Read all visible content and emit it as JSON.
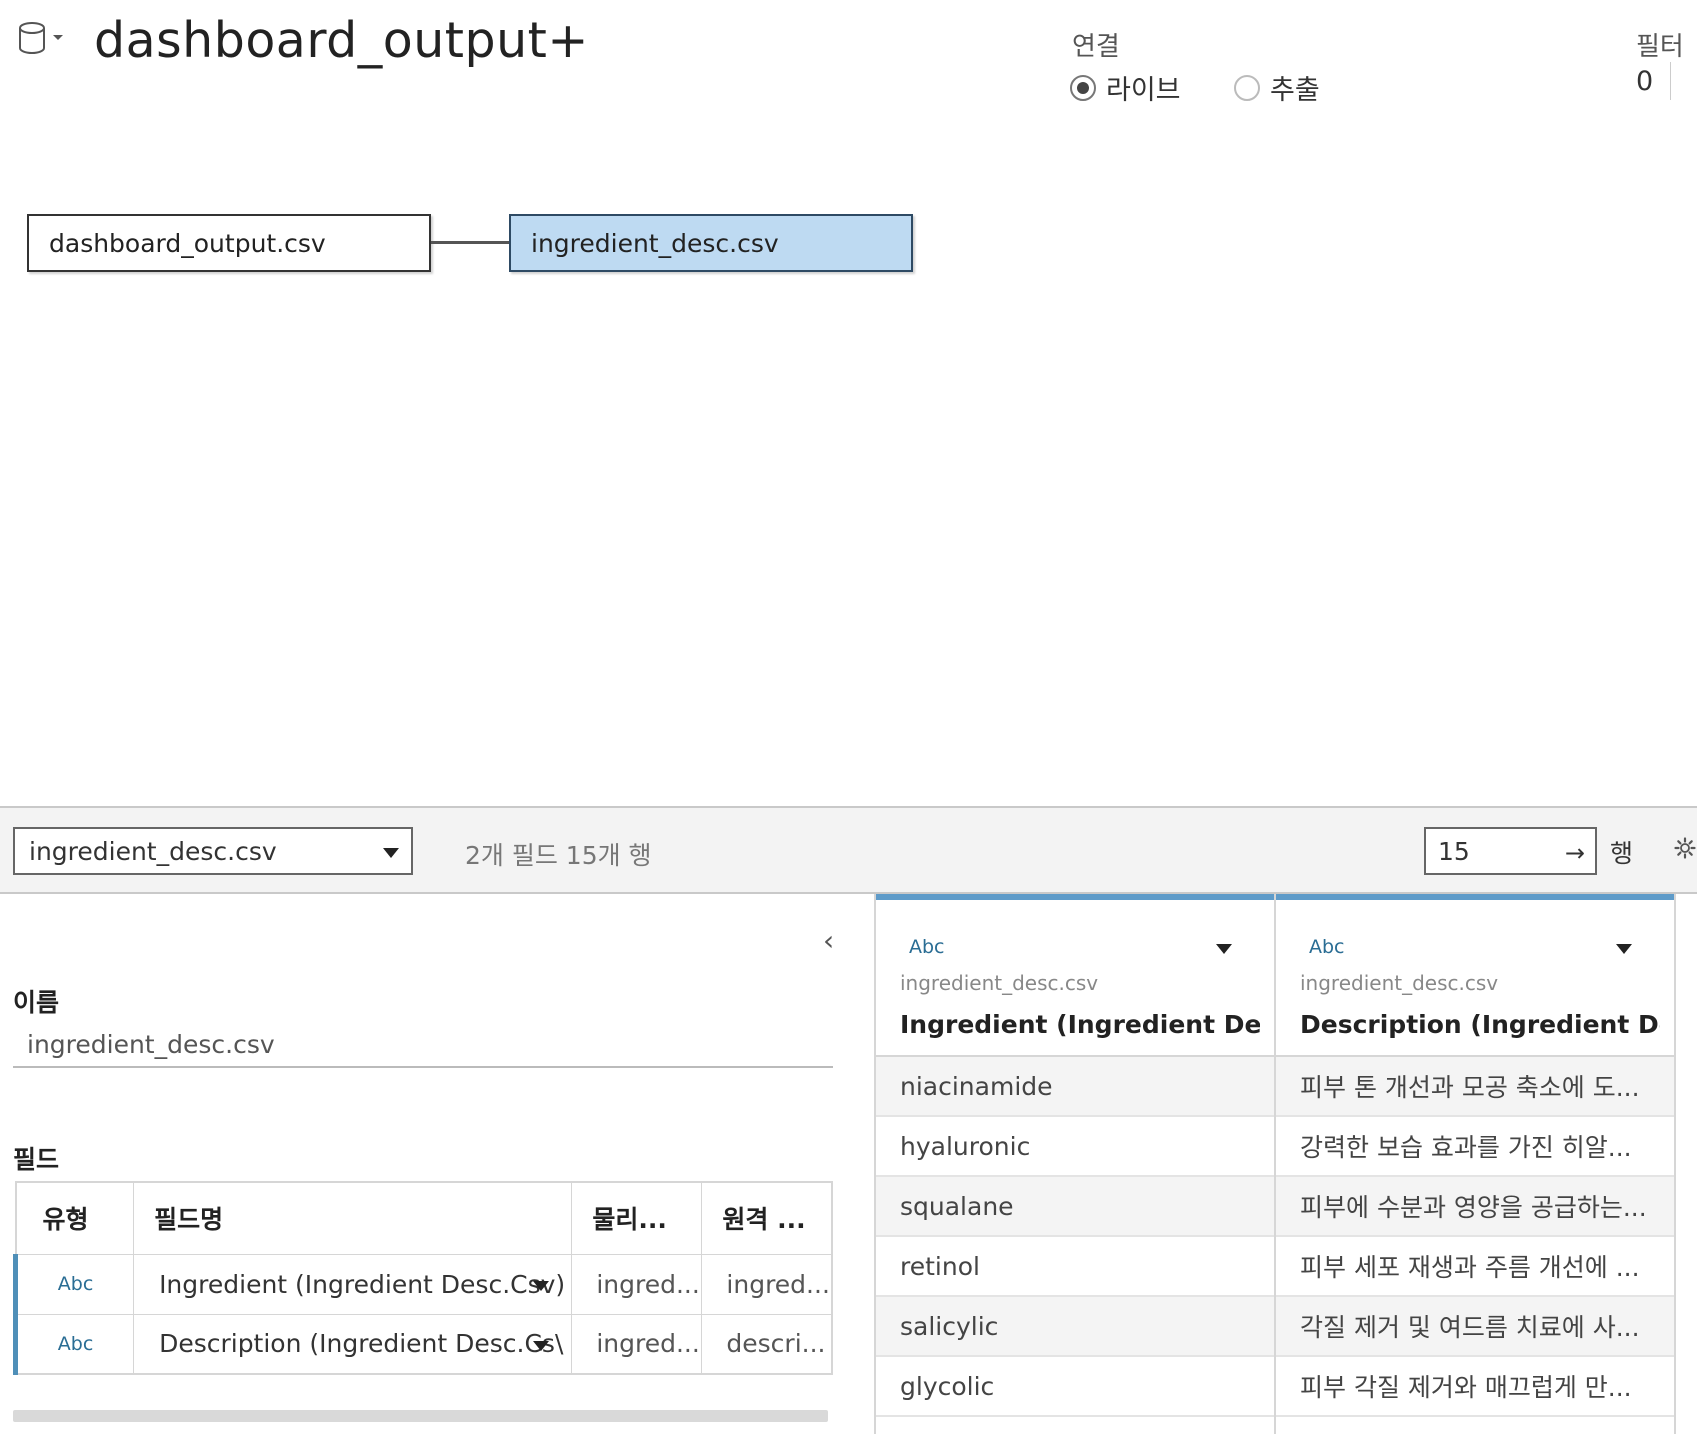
{
  "header": {
    "datasource_title": "dashboard_output+",
    "datasource_icon": "database-icon",
    "connection_label": "연결",
    "connection_options": [
      {
        "label": "라이브",
        "selected": true
      },
      {
        "label": "추출",
        "selected": false
      }
    ],
    "filter_label": "필터",
    "filter_count": "0"
  },
  "canvas": {
    "left_table": "dashboard_output.csv",
    "right_table": "ingredient_desc.csv",
    "selected_color": "#bedaf2"
  },
  "toolbar": {
    "table_select_value": "ingredient_desc.csv",
    "field_summary": "2개 필드 15개 행",
    "row_limit": "15",
    "row_unit": "행",
    "go_arrow": "→",
    "gear_icon": "gear-icon"
  },
  "metadata": {
    "collapse_glyph": "‹",
    "name_label": "이름",
    "name_value": "ingredient_desc.csv",
    "fields_label": "필드",
    "columns": [
      "유형",
      "필드명",
      "물리...",
      "원격 ..."
    ],
    "rows": [
      {
        "type": "Abc",
        "field": "Ingredient (Ingredient Desc.Csv)",
        "physical": "ingred...",
        "remote": "ingred..."
      },
      {
        "type": "Abc",
        "field": "Description (Ingredient Desc.Cs\\",
        "physical": "ingred...",
        "remote": "descri..."
      }
    ]
  },
  "grid": {
    "columns": [
      {
        "type": "Abc",
        "source": "ingredient_desc.csv",
        "name": "Ingredient (Ingredient Des"
      },
      {
        "type": "Abc",
        "source": "ingredient_desc.csv",
        "name": "Description (Ingredient De"
      }
    ],
    "rows": [
      [
        "niacinamide",
        "피부 톤 개선과 모공 축소에 도..."
      ],
      [
        "hyaluronic",
        "강력한 보습 효과를 가진 히알..."
      ],
      [
        "squalane",
        "피부에 수분과 영양을 공급하는..."
      ],
      [
        "retinol",
        "피부 세포 재생과 주름 개선에 ..."
      ],
      [
        "salicylic",
        "각질 제거 및 여드름 치료에 사..."
      ],
      [
        "glycolic",
        "피부 각질 제거와 매끄럽게 만..."
      ]
    ],
    "accent_color": "#5e9bc9",
    "type_color": "#2a6d94"
  }
}
